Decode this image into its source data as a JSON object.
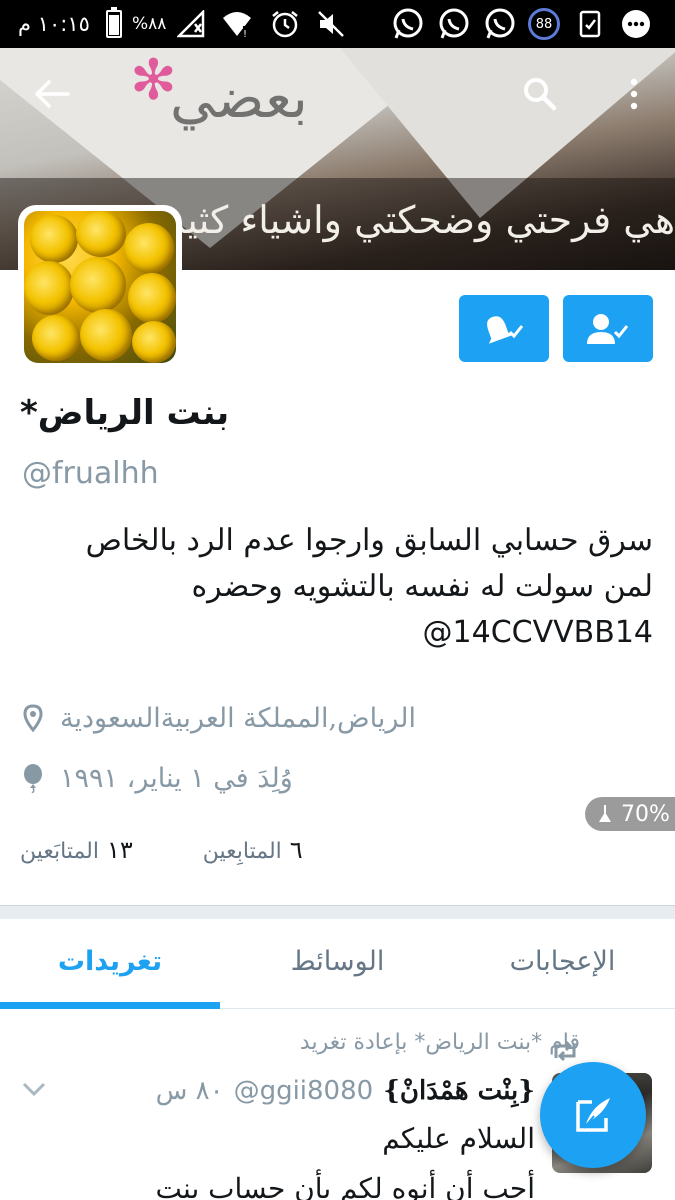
{
  "status_bar": {
    "time": "١٠:١٥ م",
    "battery_percent": "%٨٨",
    "badge_number": "88"
  },
  "header": {
    "banner_top_text": "بعضي",
    "banner_text": "هي فرحتي وضحكتي واشياء كثير"
  },
  "profile": {
    "display_name": "*بنت الرياض",
    "handle": "@frualhh",
    "bio_line1": "سرق حسابي السابق وارجوا عدم الرد بالخاص",
    "bio_line2": "لمن سولت له نفسه بالتشويه وحضره",
    "bio_mention": "@14CCVVBB14",
    "location": "الرياض,المملكة العربيةالسعودية",
    "birthday": "وُلِدَ في ١ يناير، ١٩٩١",
    "following_count": "٦",
    "following_label": "المتابِعين",
    "followers_count": "١٣",
    "followers_label": "المتابَعين"
  },
  "overlay": {
    "battery_badge": "70%"
  },
  "tabs": {
    "tweets": "تغريدات",
    "media": "الوسائط",
    "likes": "الإعجابات"
  },
  "tweet": {
    "retweet_context": "قام *بنت الرياض* بإعادة تغريد",
    "author_name": "{بِنْت هَمْدَانْ}",
    "author_handle": "@ggii8080",
    "time": "٨٠ س",
    "line1": "السلام عليكم",
    "line2": "أحب أن أنوه لكم بأن حساب بنت"
  },
  "colors": {
    "accent": "#1da1f2",
    "muted": "#8899a6",
    "text": "#14171a"
  }
}
